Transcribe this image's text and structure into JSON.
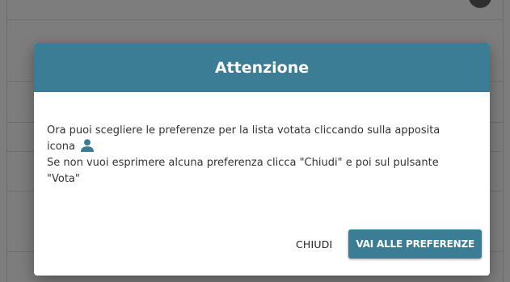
{
  "dialog": {
    "title": "Attenzione",
    "body_line1": "Ora puoi scegliere le preferenze per la lista votata cliccando sulla apposita",
    "body_line2_prefix": "icona",
    "body_icon": "user-icon",
    "body_line3": "Se non vuoi esprimere alcuna preferenza clicca \"Chiudi\" e poi sul pulsante",
    "body_line4": "\"Vota\"",
    "close_label": "CHIUDI",
    "primary_label": "VAI ALLE PREFERENZE"
  },
  "colors": {
    "accent": "#3a7d94",
    "backdrop": "#7d7d7d"
  }
}
